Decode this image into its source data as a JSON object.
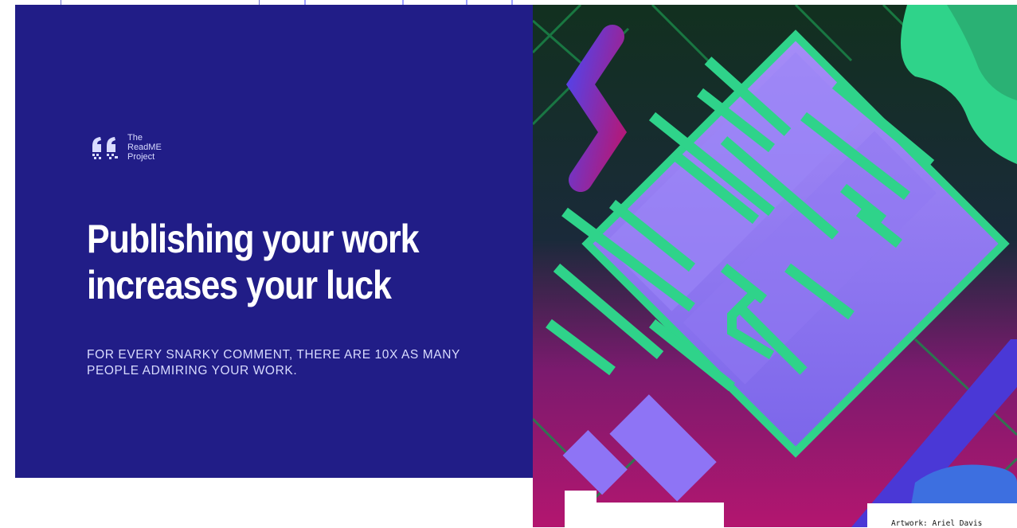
{
  "brand": {
    "line1": "The",
    "line2": "ReadME",
    "line3": "Project"
  },
  "hero": {
    "headline_line1": "Publishing your work",
    "headline_line2": "increases your luck",
    "subtext": "FOR EVERY SNARKY COMMENT, THERE ARE 10X AS MANY PEOPLE ADMIRING YOUR WORK."
  },
  "artwork": {
    "credit": "Artwork: Ariel Davis"
  },
  "colors": {
    "hero_bg": "#211d87",
    "accent_green": "#2fd38a",
    "accent_purple": "#8e74f5",
    "accent_magenta": "#b01a7c"
  }
}
